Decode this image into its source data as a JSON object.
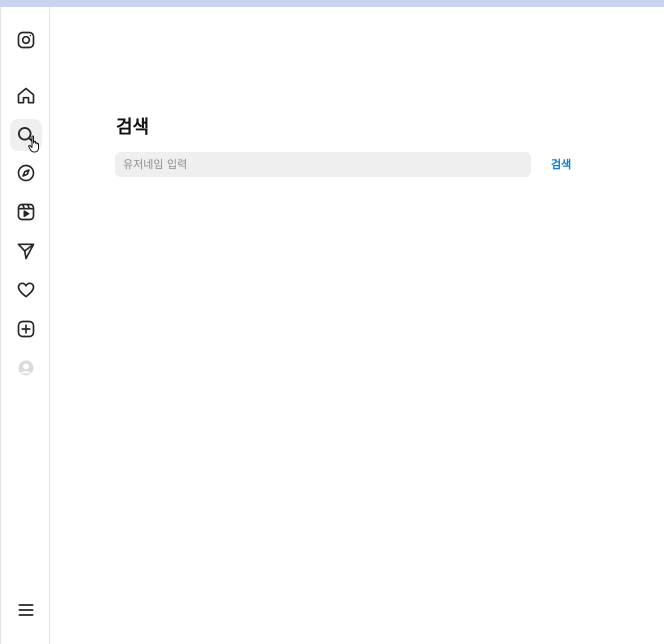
{
  "sidebar": {
    "items": [
      {
        "name": "instagram-logo-icon"
      },
      {
        "name": "home-icon"
      },
      {
        "name": "search-icon",
        "active": true
      },
      {
        "name": "explore-icon"
      },
      {
        "name": "reels-icon"
      },
      {
        "name": "messages-icon"
      },
      {
        "name": "notifications-icon"
      },
      {
        "name": "create-icon"
      },
      {
        "name": "profile-avatar-icon"
      },
      {
        "name": "menu-icon"
      }
    ]
  },
  "main": {
    "title": "검색",
    "search": {
      "placeholder": "유저네임 입력",
      "value": "",
      "button_label": "검색"
    }
  },
  "colors": {
    "accent": "#0a7ed8",
    "input_bg": "#efefef",
    "topbar": "#c8d3ee"
  }
}
